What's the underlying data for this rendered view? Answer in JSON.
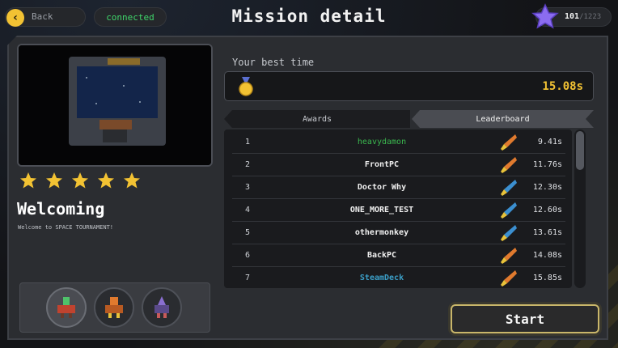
{
  "header": {
    "back_label": "Back",
    "connection_status": "connected",
    "title": "Mission detail",
    "stars_collected": "101",
    "stars_total": "/1223"
  },
  "mission": {
    "name": "Welcoming",
    "description": "Welcome to SPACE TOURNAMENT!",
    "star_rating": 5,
    "ships": [
      "green-red-ship",
      "orange-ship",
      "purple-ship"
    ],
    "selected_ship": 0
  },
  "best": {
    "label": "Your best time",
    "time": "15.08s"
  },
  "tabs": {
    "awards": "Awards",
    "leaderboard": "Leaderboard",
    "active": "Leaderboard"
  },
  "leaderboard": [
    {
      "rank": "1",
      "name": "heavydamon",
      "time": "9.41s",
      "name_color": "#3bb84f",
      "ship": "orange-ship-icon"
    },
    {
      "rank": "2",
      "name": "FrontPC",
      "time": "11.76s",
      "name_color": "#f0f0f0",
      "ship": "orange-ship-icon"
    },
    {
      "rank": "3",
      "name": "Doctor Why",
      "time": "12.30s",
      "name_color": "#f0f0f0",
      "ship": "blue-ship-icon"
    },
    {
      "rank": "4",
      "name": "ONE_MORE_TEST",
      "time": "12.60s",
      "name_color": "#f0f0f0",
      "ship": "blue-ship-icon"
    },
    {
      "rank": "5",
      "name": "othermonkey",
      "time": "13.61s",
      "name_color": "#f0f0f0",
      "ship": "blue-ship-icon"
    },
    {
      "rank": "6",
      "name": "BackPC",
      "time": "14.08s",
      "name_color": "#f0f0f0",
      "ship": "orange-ship-icon"
    },
    {
      "rank": "7",
      "name": "SteamDeck",
      "time": "15.85s",
      "name_color": "#3b9fc8",
      "ship": "orange-ship-icon"
    }
  ],
  "start_label": "Start",
  "colors": {
    "accent_yellow": "#f2c233",
    "connected_green": "#3fd46a",
    "star_purple": "#8b6cf0"
  }
}
